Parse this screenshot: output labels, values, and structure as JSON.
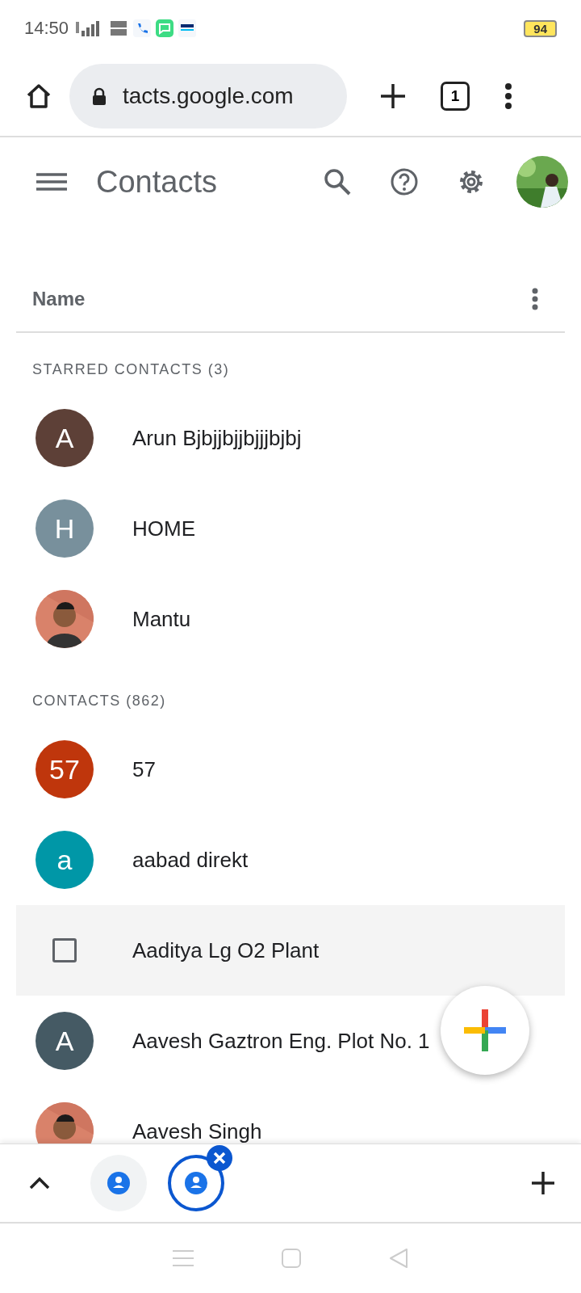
{
  "status_bar": {
    "time": "14:50",
    "battery": "94"
  },
  "browser": {
    "url": "tacts.google.com",
    "tab_count": "1"
  },
  "app_bar": {
    "title": "Contacts"
  },
  "list_header": {
    "label": "Name"
  },
  "sections": [
    {
      "title": "STARRED CONTACTS (3)",
      "contacts": [
        {
          "kind": "letter",
          "initial": "A",
          "name": "Arun Bjbjjbjjbjjjbjbj",
          "color": "#5d4037"
        },
        {
          "kind": "letter",
          "initial": "H",
          "name": "HOME",
          "color": "#78909c"
        },
        {
          "name": "Mantu"
        }
      ]
    },
    {
      "title": "CONTACTS (862)",
      "contacts": [
        {
          "kind": "letter",
          "initial": "57",
          "name": "57",
          "color": "#bf360c"
        },
        {
          "kind": "letter",
          "initial": "a",
          "name": "aabad direkt",
          "color": "#0097a7"
        },
        {
          "kind": "checkbox",
          "name": "Aaditya Lg O2 Plant",
          "checked": false
        },
        {
          "kind": "letter",
          "initial": "A",
          "name": "Aavesh Gaztron Eng. Plot No. 1",
          "color": "#455a64"
        },
        {
          "name": "Aavesh Singh"
        }
      ]
    }
  ],
  "tab_groups": [
    {
      "selected": false
    },
    {
      "selected": true
    }
  ]
}
